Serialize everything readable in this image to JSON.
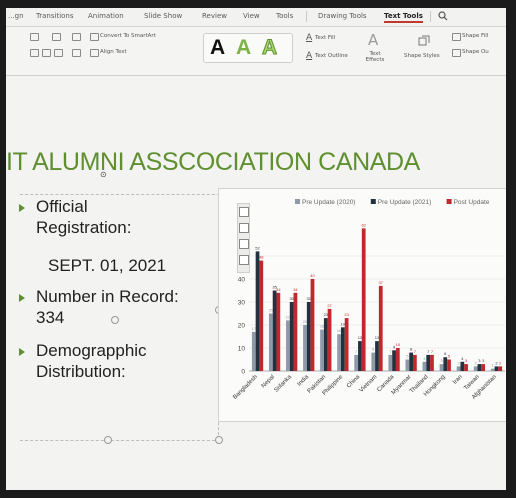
{
  "app": {
    "tabs": [
      "...gn",
      "Transitions",
      "Animation",
      "Slide Show",
      "Review",
      "View",
      "Tools",
      "Drawing Tools",
      "Text Tools"
    ],
    "active_tab": "Text Tools"
  },
  "ribbon": {
    "convert_smartart": "Convert To SmartArt",
    "align_text": "Align Text",
    "text_fill": "Text Fill",
    "text_outline": "Text Outline",
    "text_effects": "Text Effects",
    "shape_styles": "Shape Styles",
    "shape_fill": "Shape Fill",
    "shape_outline": "Shape Ou",
    "wordart_letters": [
      "A",
      "A",
      "A"
    ],
    "wordart_colors": [
      "#111111",
      "#7cb342",
      "#a5d66e"
    ]
  },
  "slide": {
    "title": "IT ALUMNI ASSCOCIATION CANADA",
    "accent_color": "#5f8f2f",
    "bullets": [
      {
        "lines": [
          "Official",
          "Registration:"
        ]
      },
      {
        "lines": [
          "SEPT. 01, 2021"
        ],
        "indent": true
      },
      {
        "lines": [
          "Number in Record:",
          "334"
        ]
      },
      {
        "lines": [
          "Demograpphic",
          "Distribution:"
        ]
      }
    ]
  },
  "chart_data": {
    "type": "bar",
    "legend_position": "top",
    "ylim": [
      0,
      60
    ],
    "yticks": [
      0,
      10,
      20,
      30,
      40,
      50
    ],
    "categories": [
      "Bangladesh",
      "Nepal",
      "Srilanka",
      "India",
      "Pakistan",
      "Philippine",
      "China",
      "Vietnam",
      "Canada",
      "Myanmar",
      "Thailand",
      "Hongkong",
      "Iran",
      "Taiwan",
      "Afghanistan"
    ],
    "series": [
      {
        "name": "Pre Update (2020)",
        "color": "#8e9aa8",
        "values": [
          17,
          25,
          22,
          20,
          18,
          16,
          7,
          8,
          7,
          5,
          4,
          3,
          2,
          2,
          1
        ]
      },
      {
        "name": "Pre Update (2021)",
        "color": "#243240",
        "values": [
          52,
          35,
          30,
          30,
          23,
          19,
          13,
          13,
          9,
          8,
          7,
          6,
          4,
          3,
          2
        ]
      },
      {
        "name": "Post Update",
        "color": "#c0282d",
        "values": [
          48,
          34,
          34,
          40,
          27,
          23,
          62,
          37,
          10,
          7,
          7,
          5,
          3,
          3,
          2
        ]
      }
    ]
  }
}
